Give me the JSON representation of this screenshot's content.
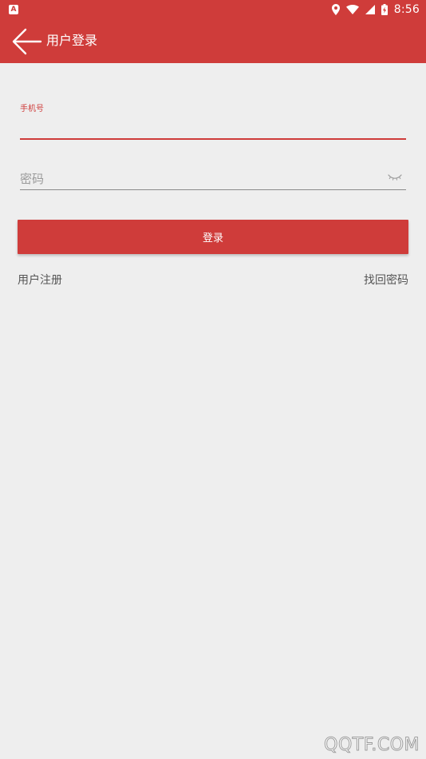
{
  "status_bar": {
    "left_icon_letter": "A",
    "time": "8:56",
    "icons": [
      "location-icon",
      "wifi-icon",
      "signal-icon",
      "battery-icon"
    ]
  },
  "app_bar": {
    "title": "用户登录",
    "back_icon": "arrow-left-icon"
  },
  "form": {
    "phone_label": "手机号",
    "phone_value": "",
    "password_placeholder": "密码",
    "password_value": "",
    "password_toggle_icon": "eye-closed-icon",
    "login_button": "登录"
  },
  "links": {
    "register": "用户注册",
    "forgot_password": "找回密码"
  },
  "watermark": "QQTF.COM",
  "colors": {
    "primary": "#cf3c3a",
    "background": "#eeeeee",
    "secondary_text": "#555555"
  }
}
